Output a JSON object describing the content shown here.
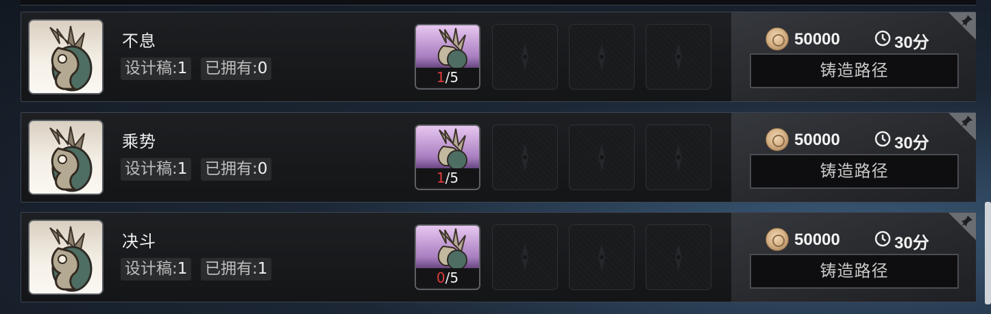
{
  "items": [
    {
      "name": "不息",
      "design_label": "设计稿:",
      "design_value": "1",
      "owned_label": "已拥有:",
      "owned_value": "0",
      "material_have": "1",
      "material_need": "/5",
      "cost": "50000",
      "time": "30分",
      "forge_label": "铸造路径"
    },
    {
      "name": "乘势",
      "design_label": "设计稿:",
      "design_value": "1",
      "owned_label": "已拥有:",
      "owned_value": "0",
      "material_have": "1",
      "material_need": "/5",
      "cost": "50000",
      "time": "30分",
      "forge_label": "铸造路径"
    },
    {
      "name": "决斗",
      "design_label": "设计稿:",
      "design_value": "1",
      "owned_label": "已拥有:",
      "owned_value": "1",
      "material_have": "0",
      "material_need": "/5",
      "cost": "50000",
      "time": "30分",
      "forge_label": "铸造路径"
    }
  ],
  "icons": {
    "item": "blade-emblem-icon",
    "currency": "coin-icon",
    "time": "clock-icon",
    "pin": "pin-icon",
    "slot": "empty-slot-emblem-icon"
  },
  "colors": {
    "insufficient": "#e33c3c",
    "row_border": "#3d4652"
  }
}
